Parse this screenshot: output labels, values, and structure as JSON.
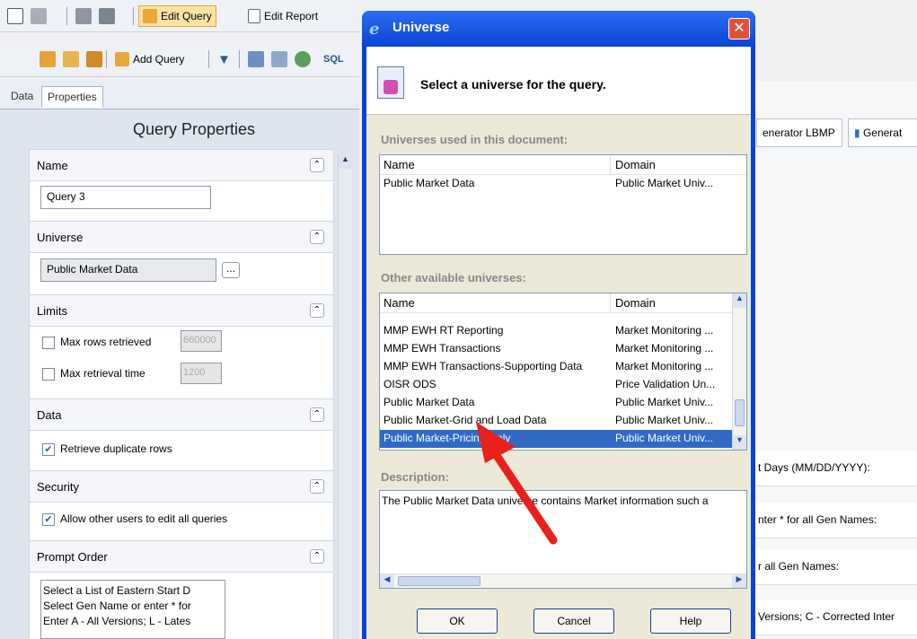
{
  "toolbar": {
    "edit_query": "Edit Query",
    "edit_report": "Edit Report",
    "add_query": "Add Query"
  },
  "left_panel": {
    "tabs": [
      "Data",
      "Properties"
    ],
    "title": "Query Properties",
    "name": {
      "label": "Name",
      "value": "Query 3"
    },
    "universe": {
      "label": "Universe",
      "value": "Public Market Data",
      "browse": "..."
    },
    "limits": {
      "label": "Limits",
      "max_rows": {
        "label": "Max rows retrieved",
        "value": "660000",
        "checked": false
      },
      "max_time": {
        "label": "Max retrieval time",
        "value": "1200",
        "checked": false
      }
    },
    "data": {
      "label": "Data",
      "retrieve_dup": "Retrieve duplicate rows",
      "checked": true
    },
    "security": {
      "label": "Security",
      "allow_edit": "Allow other users to edit all queries",
      "checked": true
    },
    "prompt_order": {
      "label": "Prompt Order",
      "items": [
        "Select a List of Eastern Start D",
        "Select Gen Name or enter * for",
        "Enter A - All Versions; L - Lates"
      ]
    }
  },
  "right_bg": {
    "tab1": "enerator LBMP",
    "tab2": "Generat",
    "row1": "t Days (MM/DD/YYYY):",
    "row2": "nter * for all Gen Names:",
    "row3": "r all Gen Names:",
    "row4": "Versions; C - Corrected Inter"
  },
  "dialog": {
    "title": "Universe",
    "heading": "Select a universe for the query.",
    "used_label": "Universes used in this document:",
    "columns": {
      "name": "Name",
      "domain": "Domain"
    },
    "used": [
      {
        "name": "Public Market Data",
        "domain": "Public Market Univ..."
      }
    ],
    "other_label": "Other available universes:",
    "other": [
      {
        "name": "MMP EWH RT Reporting",
        "domain": "Market Monitoring ..."
      },
      {
        "name": "MMP EWH Transactions",
        "domain": "Market Monitoring ..."
      },
      {
        "name": "MMP EWH Transactions-Supporting Data",
        "domain": "Market Monitoring ..."
      },
      {
        "name": "OISR ODS",
        "domain": "Price Validation Un..."
      },
      {
        "name": "Public Market Data",
        "domain": "Public Market Univ..."
      },
      {
        "name": "Public Market-Grid and Load Data",
        "domain": "Public Market Univ..."
      },
      {
        "name": "Public Market-Pricing Only",
        "domain": "Public Market Univ..."
      }
    ],
    "selected_index": 6,
    "desc_label": "Description:",
    "description": "The Public Market Data universe contains Market information such a",
    "buttons": {
      "ok": "OK",
      "cancel": "Cancel",
      "help": "Help"
    }
  },
  "colors": {
    "arrow": "#e8211a",
    "selection": "#316ac5",
    "titlebar": "#0a43d6"
  }
}
